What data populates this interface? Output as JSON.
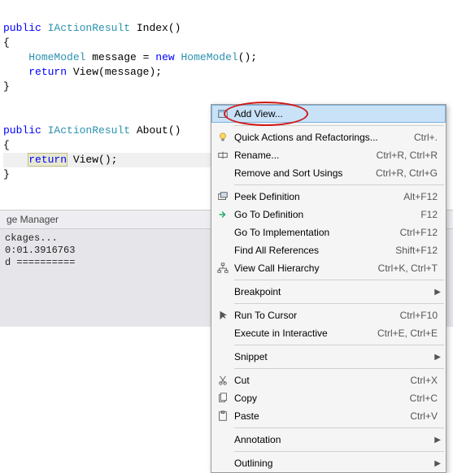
{
  "code": {
    "kw_public": "public",
    "type_IActionResult": "IActionResult",
    "name_Index": " Index()",
    "brace_open": "{",
    "type_HomeModel": "HomeModel",
    "decl_msg": " message = ",
    "kw_new": "new",
    "ctor_call": "();",
    "kw_return": "return",
    "call_view_msg": " View(message);",
    "brace_close": "}",
    "name_About": " About()",
    "call_view": " View();"
  },
  "panel": {
    "tab": "ge Manager",
    "out_line1": "ckages...",
    "out_line2": "0:01.3916763",
    "out_line3": "d =========="
  },
  "menu": {
    "items": [
      {
        "icon": "view",
        "label": "Add View...",
        "shortcut": "",
        "sel": true
      },
      {
        "sep": true
      },
      {
        "icon": "bulb",
        "label": "Quick Actions and Refactorings...",
        "shortcut": "Ctrl+."
      },
      {
        "icon": "rename",
        "label": "Rename...",
        "shortcut": "Ctrl+R, Ctrl+R"
      },
      {
        "icon": "",
        "label": "Remove and Sort Usings",
        "shortcut": "Ctrl+R, Ctrl+G"
      },
      {
        "sep": true
      },
      {
        "icon": "peek",
        "label": "Peek Definition",
        "shortcut": "Alt+F12"
      },
      {
        "icon": "goto",
        "label": "Go To Definition",
        "shortcut": "F12"
      },
      {
        "icon": "",
        "label": "Go To Implementation",
        "shortcut": "Ctrl+F12"
      },
      {
        "icon": "",
        "label": "Find All References",
        "shortcut": "Shift+F12"
      },
      {
        "icon": "hier",
        "label": "View Call Hierarchy",
        "shortcut": "Ctrl+K, Ctrl+T"
      },
      {
        "sep": true
      },
      {
        "icon": "",
        "label": "Breakpoint",
        "shortcut": "",
        "sub": true
      },
      {
        "sep": true
      },
      {
        "icon": "cursor",
        "label": "Run To Cursor",
        "shortcut": "Ctrl+F10"
      },
      {
        "icon": "",
        "label": "Execute in Interactive",
        "shortcut": "Ctrl+E, Ctrl+E"
      },
      {
        "sep": true
      },
      {
        "icon": "",
        "label": "Snippet",
        "shortcut": "",
        "sub": true
      },
      {
        "sep": true
      },
      {
        "icon": "cut",
        "label": "Cut",
        "shortcut": "Ctrl+X"
      },
      {
        "icon": "copy",
        "label": "Copy",
        "shortcut": "Ctrl+C"
      },
      {
        "icon": "paste",
        "label": "Paste",
        "shortcut": "Ctrl+V"
      },
      {
        "sep": true
      },
      {
        "icon": "",
        "label": "Annotation",
        "shortcut": "",
        "sub": true
      },
      {
        "sep": true
      },
      {
        "icon": "",
        "label": "Outlining",
        "shortcut": "",
        "sub": true
      }
    ]
  }
}
